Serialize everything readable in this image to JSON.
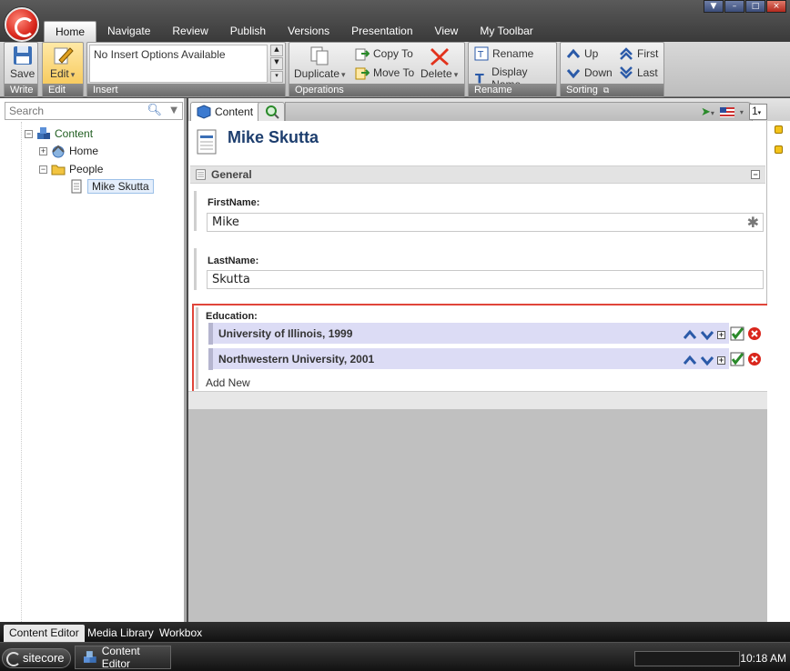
{
  "window": {
    "min": "▼",
    "restore": "–",
    "max": "□",
    "close": "×"
  },
  "ribbon": {
    "tabs": [
      "Home",
      "Navigate",
      "Review",
      "Publish",
      "Versions",
      "Presentation",
      "View",
      "My Toolbar"
    ],
    "active_tab": "Home",
    "groups": {
      "write": {
        "label": "Write",
        "save": "Save"
      },
      "edit": {
        "label": "Edit",
        "edit": "Edit"
      },
      "insert": {
        "label": "Insert",
        "empty": "No Insert Options Available"
      },
      "operations": {
        "label": "Operations",
        "duplicate": "Duplicate",
        "copy_to": "Copy To",
        "move_to": "Move To",
        "delete": "Delete"
      },
      "rename": {
        "label": "Rename",
        "rename": "Rename",
        "display_name": "Display Name"
      },
      "sorting": {
        "label": "Sorting",
        "up": "Up",
        "down": "Down",
        "first": "First",
        "last": "Last"
      }
    },
    "accent": "#d9261c"
  },
  "tree": {
    "search_placeholder": "Search",
    "root": "Content",
    "home": "Home",
    "people": "People",
    "selected": "Mike Skutta",
    "toggles": {
      "root": "−",
      "home": "+",
      "people": "−"
    }
  },
  "editor": {
    "tabs": {
      "content": "Content"
    },
    "version": "1",
    "item_title": "Mike Skutta",
    "section": "General",
    "section_toggle": "−",
    "fields": {
      "first_name_label": "FirstName:",
      "first_name": "Mike",
      "last_name_label": "LastName:",
      "last_name": "Skutta"
    },
    "education": {
      "label": "Education:",
      "rows": [
        "University of Illinois, 1999",
        "Northwestern University, 2001"
      ],
      "add_new": "Add New",
      "highlight": "#e0453a"
    }
  },
  "bottom_tabs": [
    "Content Editor",
    "Media Library",
    "Workbox"
  ],
  "taskbar": {
    "start": "sitecore",
    "task": "Content Editor",
    "clock": "10:18 AM"
  }
}
